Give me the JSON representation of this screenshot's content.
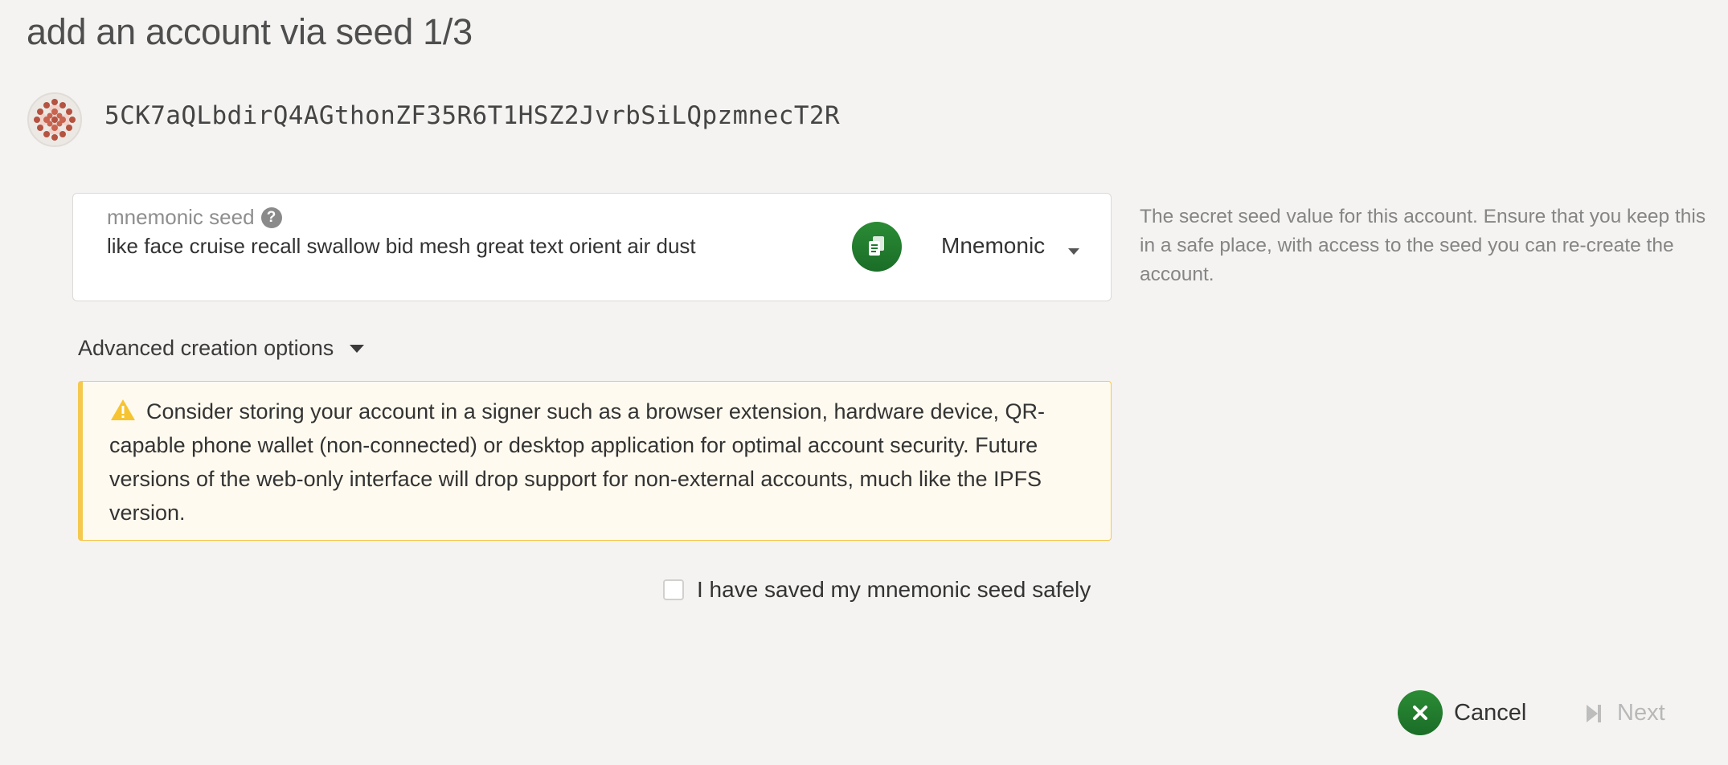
{
  "page": {
    "title": "add an account via seed 1/3"
  },
  "account": {
    "address": "5CK7aQLbdirQ4AGthonZF35R6T1HSZ2JvrbSiLQpzmnecT2R",
    "identicon": "identicon"
  },
  "seed": {
    "label": "mnemonic seed",
    "help_icon": "?",
    "value": "like face cruise recall swallow bid mesh great text orient air dust",
    "copy_icon": "copy-icon",
    "type_selected": "Mnemonic",
    "help_text": "The secret seed value for this account. Ensure that you keep this in a safe place, with access to the seed you can re-create the account."
  },
  "advanced": {
    "label": "Advanced creation options"
  },
  "warning": {
    "text": "Consider storing your account in a signer such as a browser extension, hardware device, QR-capable phone wallet (non-connected) or desktop application for optimal account security. Future versions of the web-only interface will drop support for non-external accounts, much like the IPFS version."
  },
  "confirm": {
    "label": "I have saved my mnemonic seed safely",
    "checked": false
  },
  "actions": {
    "cancel": "Cancel",
    "next": "Next"
  },
  "colors": {
    "accent_green": "#1f7a2c",
    "warning_border": "#f5c84f",
    "warning_bg": "#fffaef",
    "background": "#f4f3f1"
  }
}
